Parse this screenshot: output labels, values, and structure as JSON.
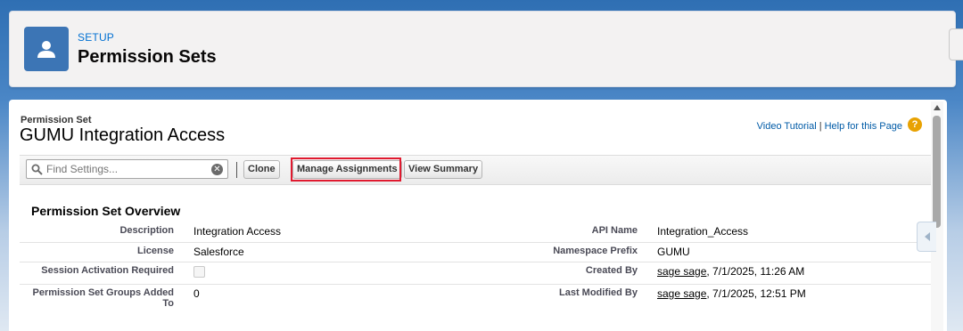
{
  "header": {
    "eyebrow": "SETUP",
    "title": "Permission Sets"
  },
  "record": {
    "type_label": "Permission Set",
    "name": "GUMU Integration Access"
  },
  "help": {
    "video_tutorial": "Video Tutorial",
    "separator": "|",
    "help_page": "Help for this Page",
    "help_icon_glyph": "?"
  },
  "toolbar": {
    "search_placeholder": "Find Settings...",
    "clear_glyph": "✕",
    "clone_label": "Clone",
    "manage_assignments_label": "Manage Assignments",
    "view_summary_label": "View Summary"
  },
  "overview": {
    "section_title": "Permission Set Overview",
    "rows": [
      {
        "label_left": "Description",
        "value_left": "Integration Access",
        "label_right": "API Name",
        "value_right": "Integration_Access"
      },
      {
        "label_left": "License",
        "value_left": "Salesforce",
        "label_right": "Namespace Prefix",
        "value_right": "GUMU"
      },
      {
        "label_left": "Session Activation Required",
        "value_left": "",
        "label_right": "Created By",
        "value_right_user": "sage sage",
        "value_right_date": ", 7/1/2025, 11:26 AM"
      },
      {
        "label_left": "Permission Set Groups Added To",
        "value_left": "0",
        "label_right": "Last Modified By",
        "value_right_user": "sage sage",
        "value_right_date": ", 7/1/2025, 12:51 PM"
      }
    ]
  },
  "colors": {
    "accent_link": "#015ba7",
    "header_icon_bg": "#3c75b5",
    "highlight_border": "#e01a2f",
    "help_icon": "#e8a202"
  },
  "icons": {
    "header": "user-icon",
    "search": "search-icon",
    "clear": "clear-icon",
    "help": "help-icon",
    "side_tab": "chevron-left-icon"
  }
}
